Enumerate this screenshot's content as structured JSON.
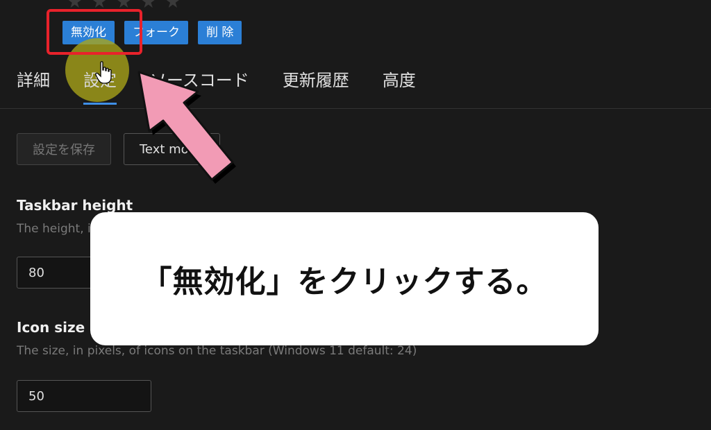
{
  "rating": {
    "stars": 5
  },
  "actions": {
    "disable": "無効化",
    "fork": "フォーク",
    "delete": "削 除"
  },
  "tabs": [
    {
      "label": "詳細"
    },
    {
      "label": "設定"
    },
    {
      "label": "ソースコード"
    },
    {
      "label": "更新履歴"
    },
    {
      "label": "高度"
    }
  ],
  "toolbar": {
    "save": "設定を保存",
    "text_mode": "Text mode"
  },
  "settings": {
    "taskbar_height": {
      "title": "Taskbar height",
      "desc": "The height, in pixels, of the taskbar",
      "value": "80"
    },
    "icon_size": {
      "title": "Icon size",
      "desc": "The size, in pixels, of icons on the taskbar (Windows 11 default: 24)",
      "value": "50"
    }
  },
  "caption": "「無効化」をクリックする。"
}
